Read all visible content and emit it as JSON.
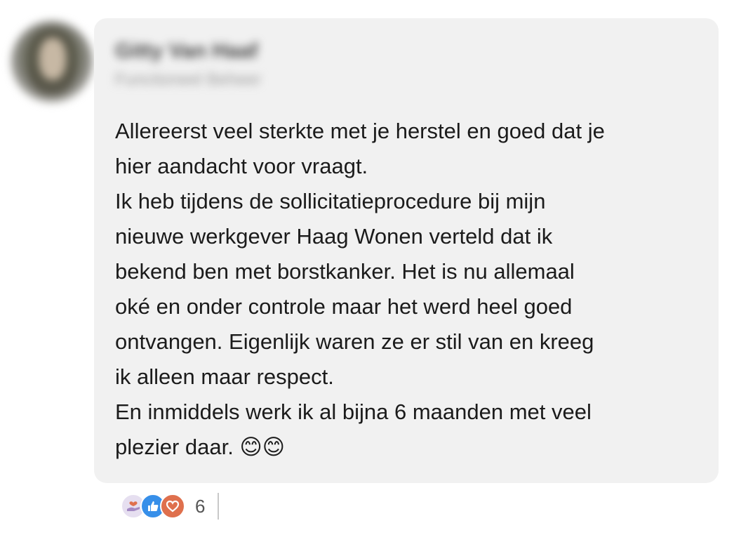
{
  "comment": {
    "author": {
      "name": "Gitty Van Haaf",
      "headline": "Functioneel Beheer"
    },
    "text_lines": [
      "Allereerst veel sterkte met je herstel en goed dat je",
      "hier aandacht voor vraagt.",
      "Ik heb tijdens de sollicitatieprocedure bij mijn",
      "nieuwe werkgever Haag Wonen verteld dat ik",
      "bekend ben met borstkanker. Het is nu allemaal",
      "oké en onder controle maar het werd heel goed",
      "ontvangen. Eigenlijk waren ze er stil van en kreeg",
      "ik alleen maar respect.",
      "En inmiddels werk ik al bijna 6 maanden met veel",
      "plezier daar. 😊😊"
    ],
    "reactions": {
      "icons": [
        "support-icon",
        "like-icon",
        "love-icon"
      ],
      "count": "6"
    }
  },
  "colors": {
    "bubble_bg": "#f1f1f1",
    "like": "#378fe9",
    "love": "#df704d",
    "support": "#e6dff0"
  }
}
